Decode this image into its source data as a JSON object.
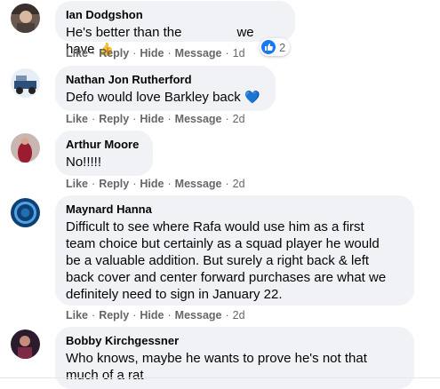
{
  "colors": {
    "bubble": "#f0f2f5",
    "meta_text": "#65676b",
    "like_blue": "#1877f2"
  },
  "comments": [
    {
      "author": "Ian Dodgshon",
      "text_before": "He's better than the",
      "text_after": "we have",
      "text_emoji": "👍",
      "actions": {
        "like": "Like",
        "reply": "Reply",
        "hide": "Hide",
        "message": "Message",
        "time": "1d"
      },
      "reaction_count": "2",
      "reaction_icon": "thumbs-up-icon"
    },
    {
      "author": "Nathan Jon Rutherford",
      "text": "Defo would love Barkley back",
      "text_emoji": "💙",
      "actions": {
        "like": "Like",
        "reply": "Reply",
        "hide": "Hide",
        "message": "Message",
        "time": "2d"
      }
    },
    {
      "author": "Arthur Moore",
      "text": "No!!!!!",
      "actions": {
        "like": "Like",
        "reply": "Reply",
        "hide": "Hide",
        "message": "Message",
        "time": "2d"
      }
    },
    {
      "author": "Maynard Hanna",
      "lines": [
        "Difficult to see where Rafa would use him as a first",
        "team choice but certainly as a squad player he would",
        "be a valuable addition. But surely a right back & left",
        "back cover and center forward purchases are what we",
        "definitely need to sign in January 22."
      ],
      "actions": {
        "like": "Like",
        "reply": "Reply",
        "hide": "Hide",
        "message": "Message",
        "time": "2d"
      }
    },
    {
      "author": "Bobby Kirchgessner",
      "lines": [
        "Who knows, maybe he wants to prove he's not that",
        "much of a rat"
      ]
    }
  ]
}
